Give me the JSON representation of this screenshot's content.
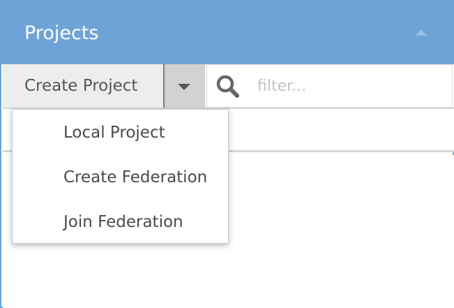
{
  "panel": {
    "title": "Projects",
    "collapse_icon": "chevron-up-icon"
  },
  "toolbar": {
    "create_label": "Create Project",
    "dropdown_icon": "caret-down-icon",
    "search_icon": "search-icon",
    "filter": {
      "value": "",
      "placeholder": "filter..."
    }
  },
  "create_menu": {
    "items": [
      {
        "label": "Local Project"
      },
      {
        "label": "Create Federation"
      },
      {
        "label": "Join Federation"
      }
    ]
  },
  "colors": {
    "header_bg": "#6ea3d8",
    "button_bg": "#ededed",
    "toggle_bg": "#d2d2d2",
    "text": "#555555"
  }
}
